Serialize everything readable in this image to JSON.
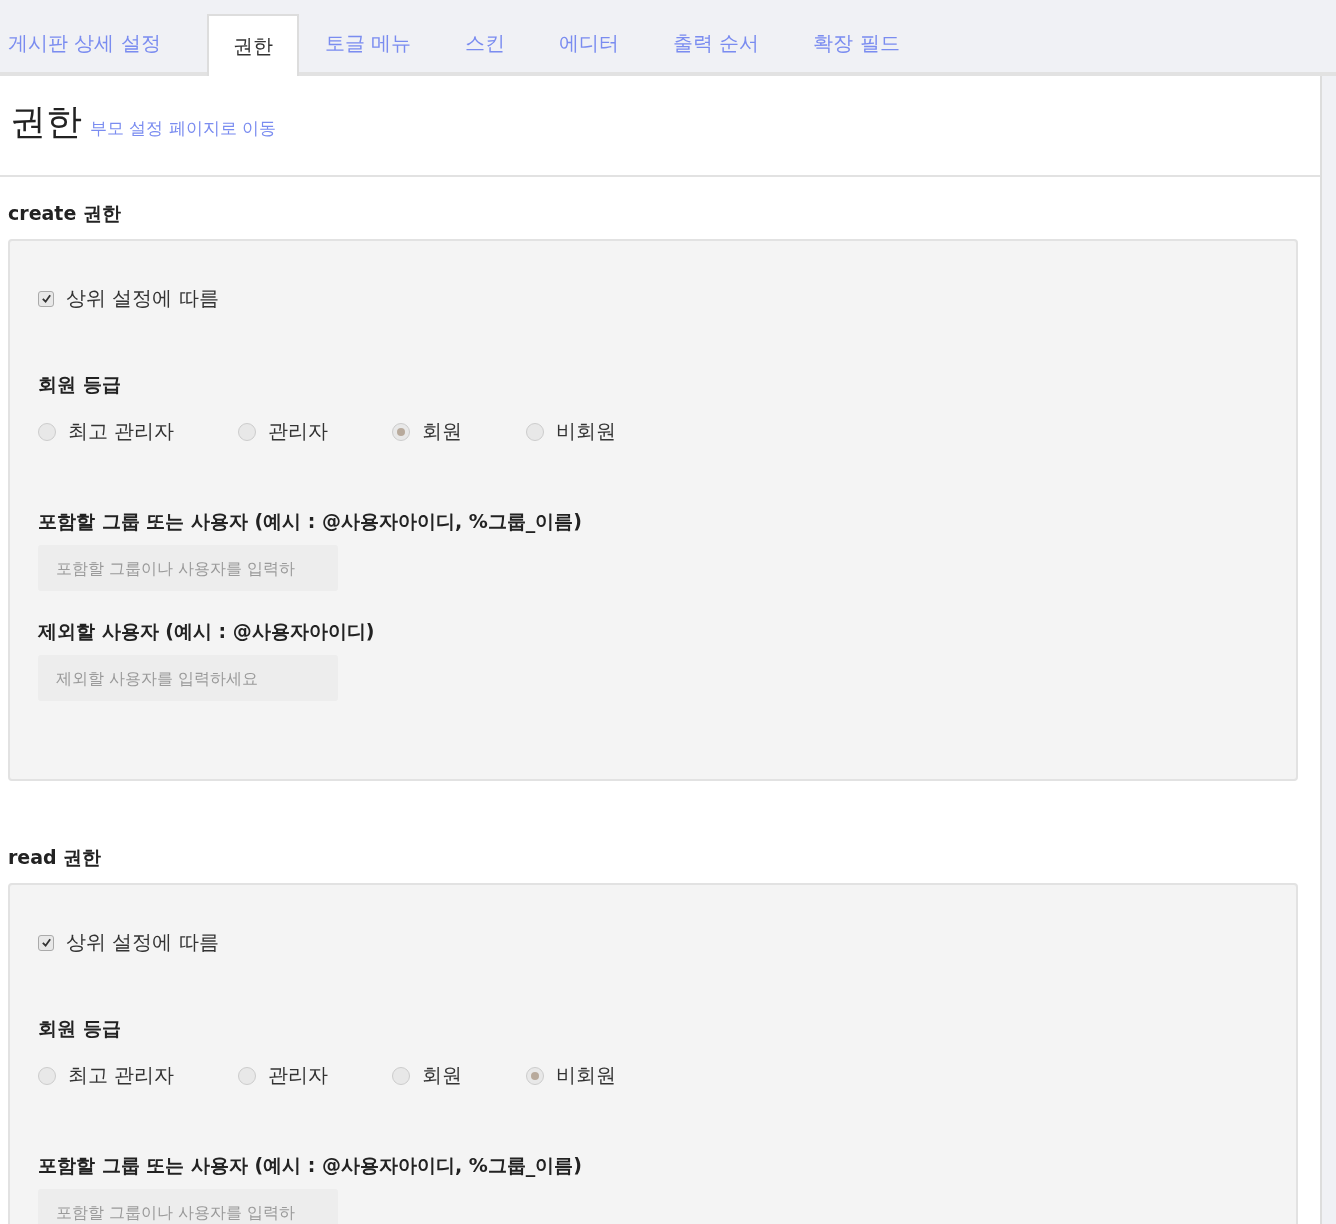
{
  "tabs": [
    {
      "label": "게시판 상세 설정",
      "selected": false
    },
    {
      "label": "권한",
      "selected": true
    },
    {
      "label": "토글 메뉴",
      "selected": false
    },
    {
      "label": "스킨",
      "selected": false
    },
    {
      "label": "에디터",
      "selected": false
    },
    {
      "label": "출력 순서",
      "selected": false
    },
    {
      "label": "확장 필드",
      "selected": false
    }
  ],
  "header": {
    "title": "권한",
    "parent_link": "부모 설정 페이지로 이동"
  },
  "sections": [
    {
      "title": "create 권한",
      "inherit": {
        "label": "상위 설정에 따름",
        "checked": true
      },
      "grade_label": "회원 등급",
      "grades": [
        {
          "label": "최고 관리자",
          "selected": false
        },
        {
          "label": "관리자",
          "selected": false
        },
        {
          "label": "회원",
          "selected": true
        },
        {
          "label": "비회원",
          "selected": false
        }
      ],
      "fields": [
        {
          "label": "포함할 그룹 또는 사용자 (예시 : @사용자아이디, %그룹_이름)",
          "placeholder": "포함할 그룹이나 사용자를 입력하"
        },
        {
          "label": "제외할 사용자 (예시 : @사용자아이디)",
          "placeholder": "제외할 사용자를 입력하세요"
        }
      ]
    },
    {
      "title": "read 권한",
      "inherit": {
        "label": "상위 설정에 따름",
        "checked": true
      },
      "grade_label": "회원 등급",
      "grades": [
        {
          "label": "최고 관리자",
          "selected": false
        },
        {
          "label": "관리자",
          "selected": false
        },
        {
          "label": "회원",
          "selected": false
        },
        {
          "label": "비회원",
          "selected": true
        }
      ],
      "fields": [
        {
          "label": "포함할 그룹 또는 사용자 (예시 : @사용자아이디, %그룹_이름)",
          "placeholder": "포함할 그룹이나 사용자를 입력하"
        }
      ]
    }
  ]
}
